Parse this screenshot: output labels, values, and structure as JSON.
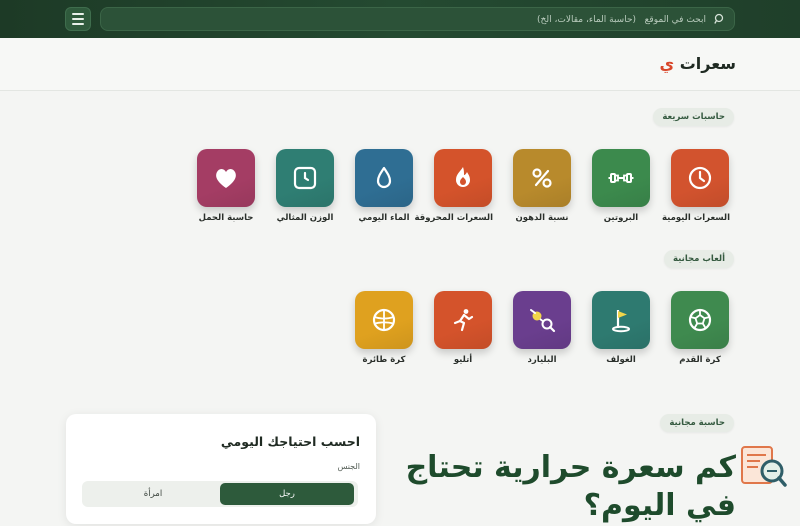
{
  "search": {
    "placeholder": "ابحث في الموقع   (حاسبة الماء، مقالات، الخ)"
  },
  "header": {
    "logo_main": "سعرات",
    "logo_accent": "ي"
  },
  "sections": {
    "quick_calculators": "حاسبات سريعة",
    "free_games": "ألعاب مجانية",
    "free_calculator": "حاسبة مجانية"
  },
  "calculators": [
    {
      "label": "السعرات اليومية",
      "icon": "clock-icon",
      "color": "#d2532e"
    },
    {
      "label": "البروتين",
      "icon": "dumbbell-icon",
      "color": "#3c8a4d"
    },
    {
      "label": "نسبة الدهون",
      "icon": "percent-icon",
      "color": "#b88a2c"
    },
    {
      "label": "السعرات المحروقة",
      "icon": "flame-icon",
      "color": "#d4532b"
    },
    {
      "label": "الماء اليومي",
      "icon": "water-drop-icon",
      "color": "#2f6e93"
    },
    {
      "label": "الوزن المثالي",
      "icon": "clock-square-icon",
      "color": "#2f7e73"
    },
    {
      "label": "حاسبة الحمل",
      "icon": "heart-icon",
      "color": "#a43d64"
    }
  ],
  "games": [
    {
      "label": "كرة القدم",
      "icon": "soccer-ball-icon",
      "color": "#3f8a4f"
    },
    {
      "label": "الغولف",
      "icon": "golf-flag-icon",
      "color": "#2e7a70"
    },
    {
      "label": "البليارد",
      "icon": "billiard-icon",
      "color": "#6a3e8e"
    },
    {
      "label": "أتليو",
      "icon": "runner-icon",
      "color": "#d4532b"
    },
    {
      "label": "كرة طائرة",
      "icon": "volleyball-icon",
      "color": "#dfa11f"
    }
  ],
  "form": {
    "title": "احسب احتياجك اليومي",
    "gender_label": "الجنس",
    "male": "رجل",
    "female": "امرأة"
  },
  "hero": {
    "line1": "كم سعرة حرارية تحتاج",
    "line2": "في اليوم؟"
  }
}
